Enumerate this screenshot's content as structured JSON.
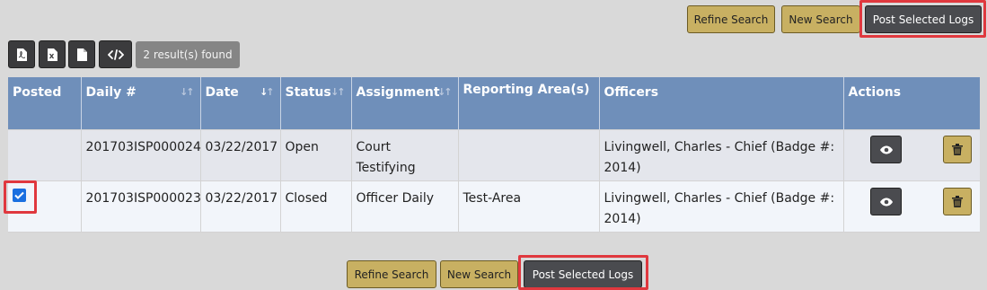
{
  "top_actions": {
    "refine": "Refine Search",
    "new": "New Search",
    "post": "Post Selected Logs"
  },
  "export": {
    "pdf_icon": "pdf-file-icon",
    "excel_icon": "excel-file-icon",
    "doc_icon": "document-icon",
    "code_icon": "code-icon"
  },
  "results_badge": "2 result(s) found",
  "table": {
    "headers": [
      "Posted",
      "Daily #",
      "Date",
      "Status",
      "Assignment",
      "Reporting Area(s)",
      "Officers",
      "Actions"
    ],
    "rows": [
      {
        "posted": false,
        "daily": "201703ISP000024",
        "date": "03/22/2017",
        "status": "Open",
        "assignment": "Court Testifying",
        "area": "",
        "officers": "Livingwell, Charles - Chief (Badge #: 2014)"
      },
      {
        "posted": true,
        "daily": "201703ISP000023",
        "date": "03/22/2017",
        "status": "Closed",
        "assignment": "Officer Daily",
        "area": "Test-Area",
        "officers": "Livingwell, Charles - Chief (Badge #: 2014)"
      }
    ]
  },
  "bottom_actions": {
    "refine": "Refine Search",
    "new": "New Search",
    "post": "Post Selected Logs"
  },
  "colors": {
    "header_bg": "#6f8fba",
    "gold_button": "#c8b062",
    "dark_button": "#4a4b4f",
    "highlight": "#e0383e"
  }
}
